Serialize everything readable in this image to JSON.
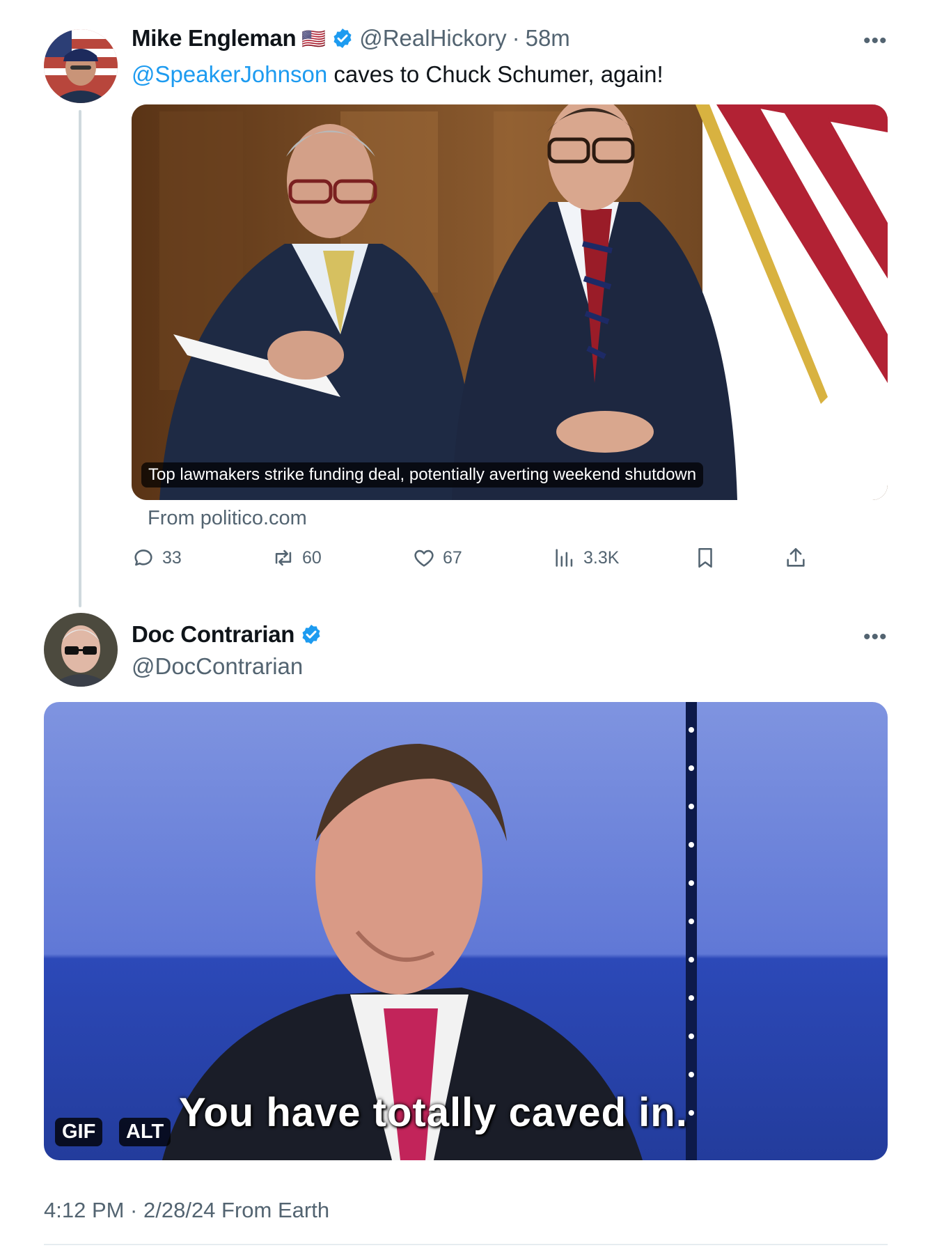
{
  "tweet1": {
    "display_name": "Mike Engleman",
    "name_emoji": "🇺🇸",
    "handle": "@RealHickory",
    "separator": "·",
    "time": "58m",
    "mention": "@SpeakerJohnson",
    "text": "caves to Chuck Schumer, again!",
    "more_label": "•••",
    "card": {
      "headline": "Top lawmakers strike funding deal, potentially averting weekend shutdown",
      "source": "From politico.com"
    },
    "actions": {
      "replies": "33",
      "reposts": "60",
      "likes": "67",
      "views": "3.3K"
    }
  },
  "tweet2": {
    "display_name": "Doc Contrarian",
    "handle": "@DocContrarian",
    "more_label": "•••",
    "gif": {
      "subtitle": "You have totally caved in.",
      "gif_badge": "GIF",
      "alt_badge": "ALT"
    },
    "timestamp": "4:12 PM · 2/28/24 From Earth"
  },
  "colors": {
    "accent": "#1d9bf0",
    "secondary_text": "#536471",
    "primary_text": "#0f1419"
  },
  "icons": [
    "verified-badge-icon",
    "more-options-icon",
    "reply-icon",
    "repost-icon",
    "like-icon",
    "views-icon",
    "bookmark-icon",
    "share-icon"
  ]
}
